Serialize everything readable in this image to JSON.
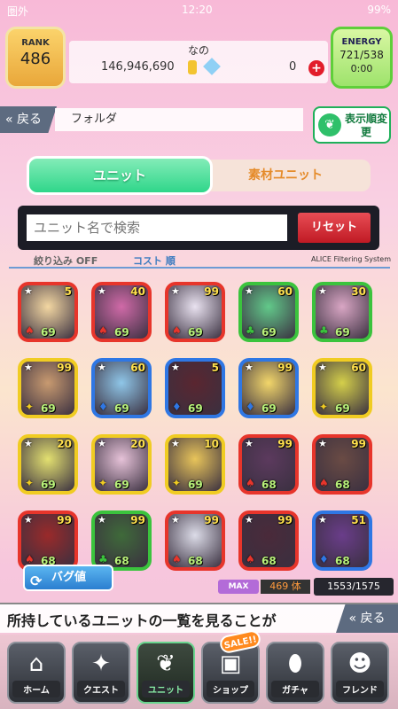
{
  "status": {
    "carrier": "圏外",
    "clock": "12:20",
    "battery": "99%"
  },
  "header": {
    "rank_label": "RANK",
    "rank_value": "486",
    "energy_label": "ENERGY",
    "energy_value": "721/538",
    "energy_timer": "0:00",
    "user_name": "なの",
    "coins": "146,946,690",
    "gems": "0",
    "plus": "+"
  },
  "nav_top": {
    "back_label": "戻る",
    "folder_label": "フォルダ",
    "sort_label": "表示順変更"
  },
  "tabs": {
    "unit": "ユニット",
    "material": "素材ユニット"
  },
  "search": {
    "placeholder": "ユニット名で検索",
    "reset": "リセット"
  },
  "filter": {
    "refine": "絞り込み OFF",
    "sort": "コスト 順",
    "system": "ALICE Filtering System"
  },
  "units": [
    {
      "lv": "5",
      "cost": "69",
      "elem": "fire"
    },
    {
      "lv": "40",
      "cost": "69",
      "elem": "fire"
    },
    {
      "lv": "99",
      "cost": "69",
      "elem": "fire"
    },
    {
      "lv": "60",
      "cost": "69",
      "elem": "wind"
    },
    {
      "lv": "30",
      "cost": "69",
      "elem": "wind"
    },
    {
      "lv": "99",
      "cost": "69",
      "elem": "light"
    },
    {
      "lv": "60",
      "cost": "69",
      "elem": "water"
    },
    {
      "lv": "5",
      "cost": "69",
      "elem": "water"
    },
    {
      "lv": "99",
      "cost": "69",
      "elem": "water"
    },
    {
      "lv": "60",
      "cost": "69",
      "elem": "light"
    },
    {
      "lv": "20",
      "cost": "69",
      "elem": "light"
    },
    {
      "lv": "20",
      "cost": "69",
      "elem": "light"
    },
    {
      "lv": "10",
      "cost": "69",
      "elem": "light"
    },
    {
      "lv": "99",
      "cost": "68",
      "elem": "fire"
    },
    {
      "lv": "99",
      "cost": "68",
      "elem": "fire"
    },
    {
      "lv": "99",
      "cost": "68",
      "elem": "fire"
    },
    {
      "lv": "99",
      "cost": "68",
      "elem": "wind"
    },
    {
      "lv": "99",
      "cost": "68",
      "elem": "fire"
    },
    {
      "lv": "99",
      "cost": "68",
      "elem": "fire"
    },
    {
      "lv": "51",
      "cost": "68",
      "elem": "water"
    }
  ],
  "footer_info": {
    "bug_label": "バグ値",
    "max_label": "MAX",
    "max_count": "469 体",
    "unit_total": "1553/1575"
  },
  "message": {
    "text": "所持しているユニットの一覧を見ることが",
    "back_label": "戻る"
  },
  "bottom_nav": [
    {
      "label": "ホーム",
      "icon": "home-icon",
      "glyph": "⌂"
    },
    {
      "label": "クエスト",
      "icon": "quest-icon",
      "glyph": "✦"
    },
    {
      "label": "ユニット",
      "icon": "unit-rabbit-icon",
      "glyph": "❦"
    },
    {
      "label": "ショップ",
      "icon": "shop-bag-icon",
      "glyph": "▣"
    },
    {
      "label": "ガチャ",
      "icon": "gacha-egg-icon",
      "glyph": "⬮"
    },
    {
      "label": "フレンド",
      "icon": "friends-icon",
      "glyph": "☻"
    }
  ],
  "sale_badge": "SALE!!",
  "colors": {
    "fire": "#e7352b",
    "wind": "#3bc33d",
    "water": "#2f77e4",
    "light": "#f0cc22",
    "accent": "#2fd68a"
  }
}
